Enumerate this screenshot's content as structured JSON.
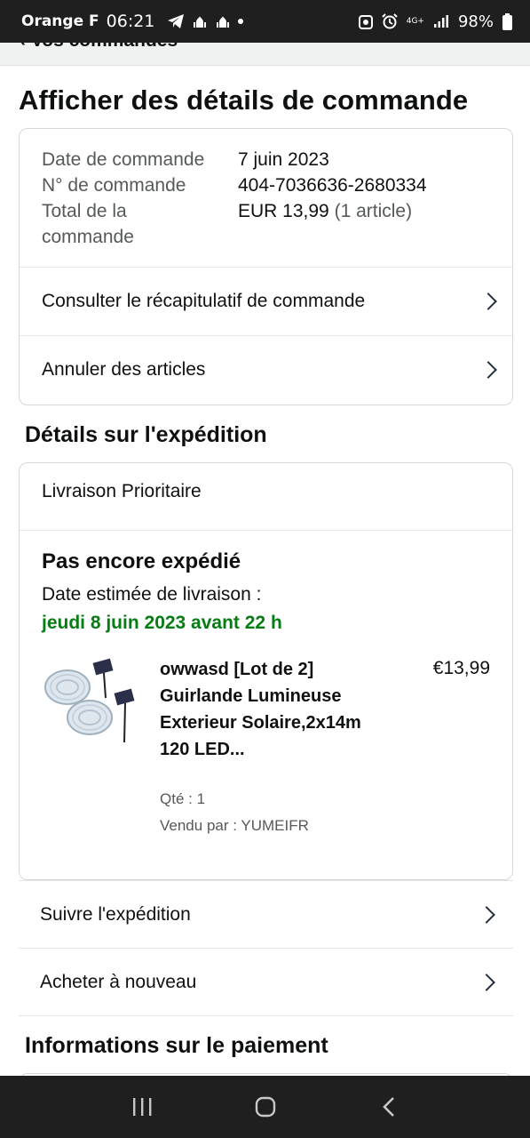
{
  "status_bar": {
    "carrier": "Orange F",
    "time": "06:21",
    "battery": "98%",
    "network": "4G+"
  },
  "nav_back": {
    "label": "‹ Vos commandes"
  },
  "page_title": "Afficher des détails de commande",
  "order_summary": {
    "date_label": "Date de commande",
    "date_value": "7 juin 2023",
    "number_label": "N° de commande",
    "number_value": "404-7036636-2680334",
    "total_label_line1": "Total de la",
    "total_label_line2": "commande",
    "total_value": "EUR 13,99",
    "total_items": "(1 article)",
    "links": [
      {
        "label": "Consulter le récapitulatif de commande"
      },
      {
        "label": "Annuler des articles"
      }
    ]
  },
  "shipment": {
    "section_title": "Détails sur l'expédition",
    "method": "Livraison Prioritaire",
    "status": "Pas encore expédié",
    "eta_label": "Date estimée de livraison :",
    "eta_date": "jeudi 8 juin 2023 avant 22 h",
    "product": {
      "title": "owwasd [Lot de 2] Guirlande Lumineuse Exterieur Solaire,2x14m 120 LED...",
      "price": "€13,99",
      "qty": "Qté : 1",
      "seller": "Vendu par : YUMEIFR"
    },
    "actions": [
      {
        "label": "Suivre l'expédition"
      },
      {
        "label": "Acheter à nouveau"
      }
    ]
  },
  "payment": {
    "section_title": "Informations sur le paiement"
  },
  "colors": {
    "eta_green": "#067d13",
    "border": "#d5d9d9",
    "text": "#0f1111",
    "muted": "#565959"
  }
}
